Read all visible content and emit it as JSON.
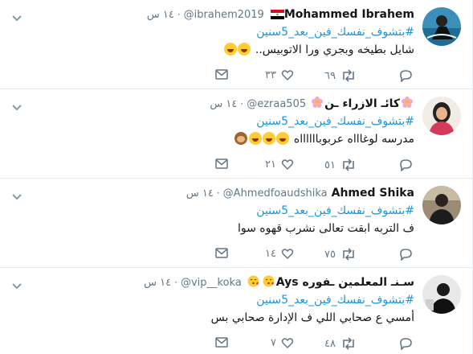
{
  "colors": {
    "link": "#1b95e0",
    "secondary": "#657786",
    "border": "#e6ecf0",
    "text": "#14171a"
  },
  "tweets": [
    {
      "name": "Mohammed Ibrahem",
      "name_emoji": "egypt-flag",
      "handle": "@ibrahem2019",
      "time": "١٤ س",
      "hashtag": "#بتشوف_نفسك_فين_بعد_5سنين",
      "text": "شايل بطيخه وبجري ورا الاتوبيس..",
      "text_emoji": [
        "face-with-tears-of-joy",
        "face-with-tears-of-joy"
      ],
      "replies": "",
      "retweets": "٦٩",
      "likes": "٣٣"
    },
    {
      "name": "كائـ الازراء ـن",
      "name_emoji": "cherry-blossom",
      "handle": "@ezraa505",
      "time": "١٤ س",
      "hashtag": "#بتشوف_نفسك_فين_بعد_5سنين",
      "text": "مدرسه لوغاااه عربوبااااااه",
      "text_emoji": [
        "face-with-tears-of-joy",
        "face-with-tears-of-joy",
        "face-with-tears-of-joy",
        "see-no-evil-monkey"
      ],
      "replies": "",
      "retweets": "٥١",
      "likes": "٢١"
    },
    {
      "name": "Ahmed Shika",
      "name_emoji": "",
      "handle": "@Ahmedfoaudshika",
      "time": "١٤ س",
      "hashtag": "#بتشوف_نفسك_فين_بعد_5سنين",
      "text": "ف التربه ابقت تعالى نشرب قهوه سوا",
      "text_emoji": [],
      "replies": "",
      "retweets": "٧٥",
      "likes": "١٤"
    },
    {
      "name": "سـنـ المعلمين ـفوره Ays",
      "name_emoji": "kissing-face-with-heart",
      "handle": "@vip__koka",
      "time": "١٤ س",
      "hashtag": "#بتشوف_نفسك_فين_بعد_5سنين",
      "text": "أمسي ع صحابي اللي ف الإدارة صحابي بس",
      "text_emoji": [],
      "replies": "",
      "retweets": "٤٨",
      "likes": "٧"
    }
  ]
}
